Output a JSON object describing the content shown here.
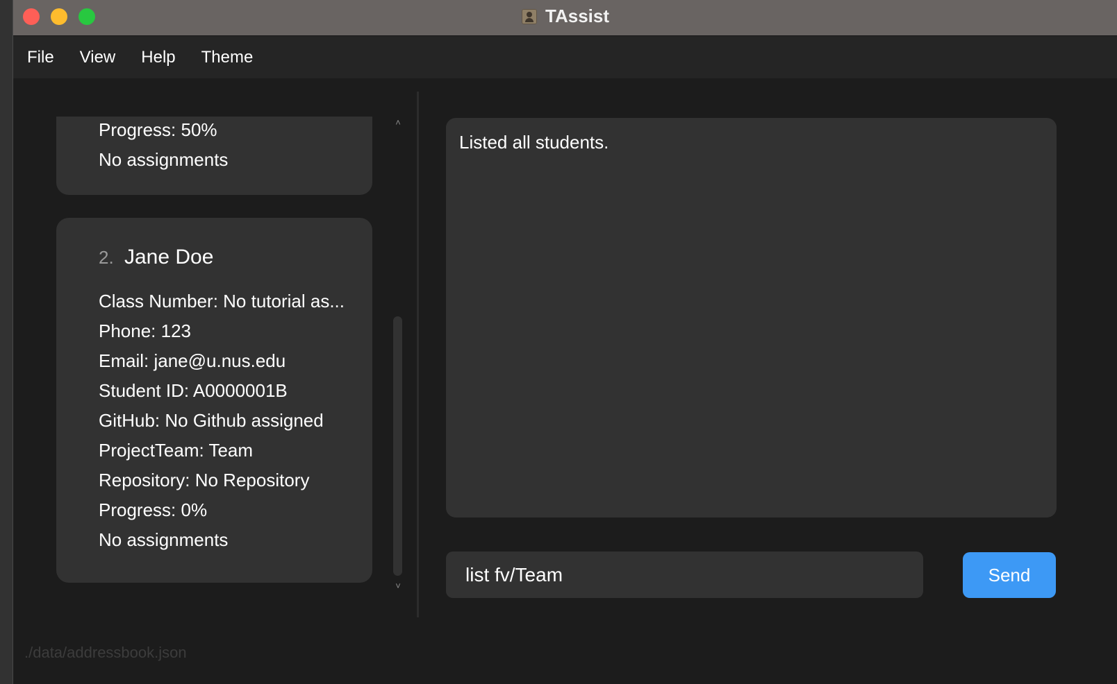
{
  "window": {
    "title": "TAssist"
  },
  "menu": {
    "items": [
      "File",
      "View",
      "Help",
      "Theme"
    ]
  },
  "persons": [
    {
      "progress": "Progress: 50%",
      "assignments": "No assignments"
    },
    {
      "index": "2.",
      "name": "Jane Doe",
      "class_number": "Class Number: No tutorial as...",
      "phone": "Phone: 123",
      "email": "Email: jane@u.nus.edu",
      "student_id": "Student ID: A0000001B",
      "github": "GitHub: No Github assigned",
      "project_team": "ProjectTeam: Team",
      "repository": "Repository: No Repository",
      "progress": "Progress: 0%",
      "assignments": "No assignments"
    }
  ],
  "result": {
    "text": "Listed all students."
  },
  "command": {
    "value": "list fv/Team"
  },
  "send": {
    "label": "Send"
  },
  "status": {
    "path": "./data/addressbook.json"
  },
  "scrollbar": {
    "up": "˄",
    "down": "˅"
  }
}
